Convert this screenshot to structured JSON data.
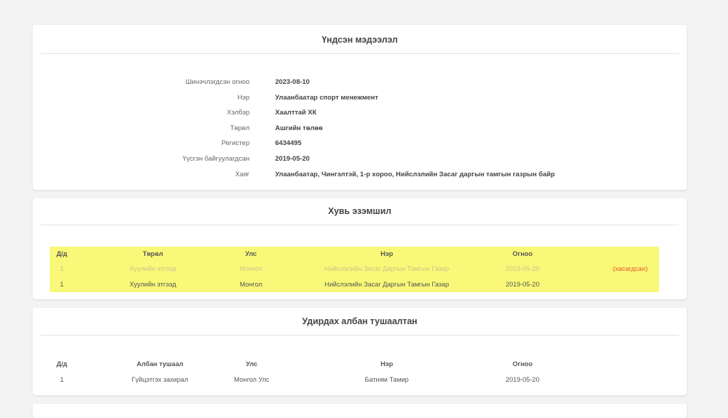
{
  "info": {
    "title": "Үндсэн мэдээлэл",
    "rows": [
      {
        "label": "Шинэчлэгдсэн огноо",
        "value": "2023-08-10"
      },
      {
        "label": "Нэр",
        "value": "Улаанбаатар спорт менежмент"
      },
      {
        "label": "Хэлбэр",
        "value": "Хаалттай ХК"
      },
      {
        "label": "Төрөл",
        "value": "Ашгийн төлөө"
      },
      {
        "label": "Регистер",
        "value": "6434495"
      },
      {
        "label": "Үүсгэн байгуулагдсан",
        "value": "2019-05-20"
      },
      {
        "label": "Хаяг",
        "value": "Улаанбаатар, Чингэлтэй, 1-р хороо, Нийслэлийн Засаг даргын тамгын газрын байр"
      }
    ]
  },
  "ownership": {
    "title": "Хувь эзэмшил",
    "headers": [
      "Д/д",
      "Төрөл",
      "Улс",
      "Нэр",
      "Огноо"
    ],
    "rows": [
      {
        "no": "1",
        "type": "Хуулийн этгээд",
        "country": "Монгол",
        "name": "Нийслэлийн Засаг Даргын Тамгын Газар",
        "date": "2019-05-20",
        "status": "(хасагдсан)"
      },
      {
        "no": "1",
        "type": "Хуулийн этгээд",
        "country": "Монгол",
        "name": "Нийслэлийн Засаг Даргын Тамгын Газар",
        "date": "2019-05-20",
        "status": ""
      }
    ],
    "highlight_color": "#f9f878",
    "removed_color": "#e65b2a"
  },
  "officers": {
    "title": "Удирдах албан тушаалтан",
    "headers": [
      "Д/д",
      "Албан тушаал",
      "Улс",
      "Нэр",
      "Огноо"
    ],
    "rows": [
      {
        "no": "1",
        "position": "Гүйцэтгэх захирал",
        "country": "Монгол Улс",
        "name": "Батням Тамир",
        "date": "2019-05-20"
      }
    ]
  }
}
